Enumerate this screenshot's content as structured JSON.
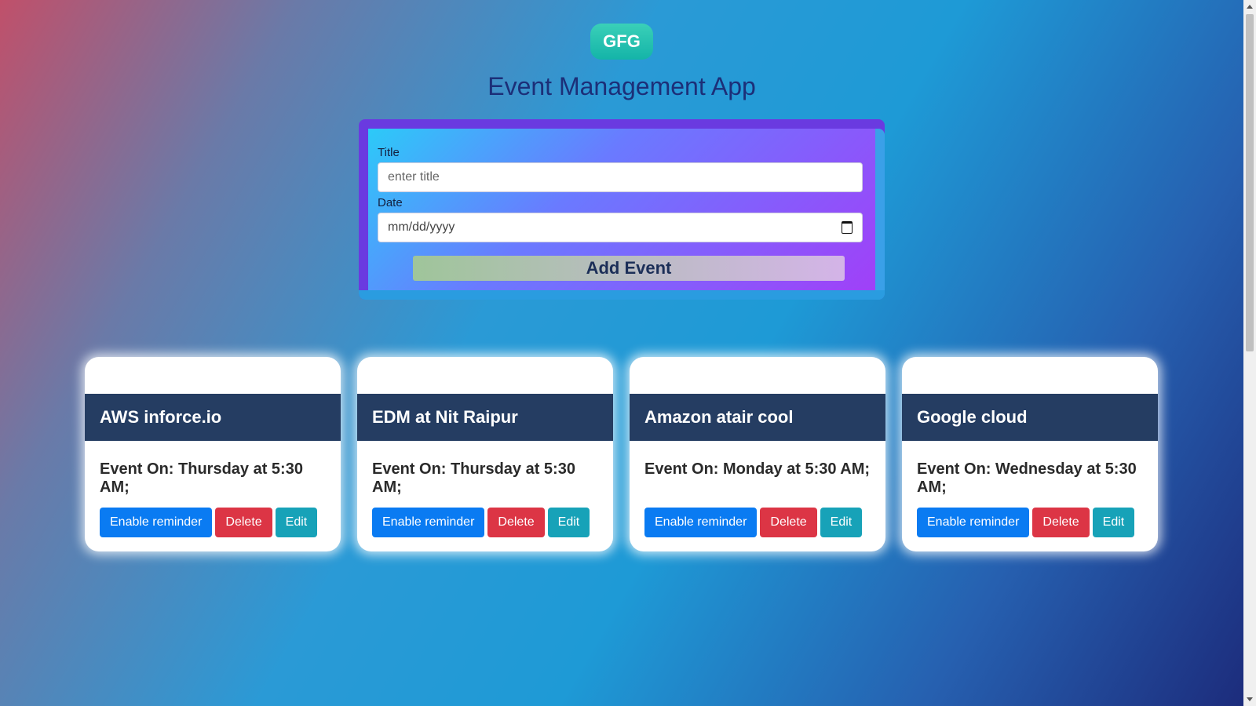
{
  "header": {
    "logo_text": "GFG",
    "title": "Event Management App"
  },
  "form": {
    "title_label": "Title",
    "title_placeholder": "enter title",
    "title_value": "",
    "date_label": "Date",
    "date_placeholder": "mm/dd/yyyy",
    "add_button_label": "Add Event",
    "icons": {
      "date_picker": "calendar-icon"
    }
  },
  "events": [
    {
      "title": "AWS inforce.io",
      "when": "Event On: Thursday at 5:30 AM;",
      "buttons": {
        "reminder": "Enable reminder",
        "delete": "Delete",
        "edit": "Edit"
      }
    },
    {
      "title": "EDM at Nit Raipur",
      "when": "Event On: Thursday at 5:30 AM;",
      "buttons": {
        "reminder": "Enable reminder",
        "delete": "Delete",
        "edit": "Edit"
      }
    },
    {
      "title": "Amazon atair cool",
      "when": "Event On: Monday at 5:30 AM;",
      "buttons": {
        "reminder": "Enable reminder",
        "delete": "Delete",
        "edit": "Edit"
      }
    },
    {
      "title": "Google cloud",
      "when": "Event On: Wednesday at 5:30 AM;",
      "buttons": {
        "reminder": "Enable reminder",
        "delete": "Delete",
        "edit": "Edit"
      }
    }
  ],
  "colors": {
    "reminder_button": "#0a7bf2",
    "delete_button": "#dc3545",
    "edit_button": "#17a2b8",
    "card_header": "#253d62",
    "title_text": "#1c2f78"
  }
}
